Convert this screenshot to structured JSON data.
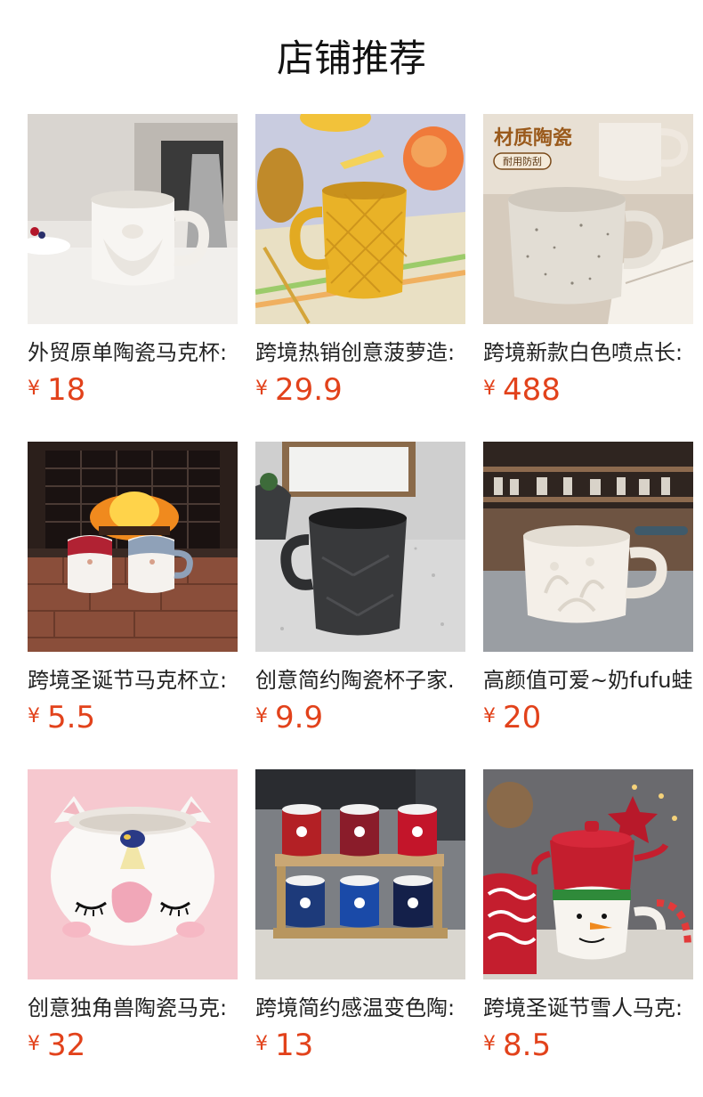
{
  "section": {
    "title": "店铺推荐"
  },
  "currency_symbol": "¥",
  "colors": {
    "price": "#e2421b",
    "title": "#111111",
    "text": "#222222"
  },
  "products": [
    {
      "name": "外贸原单陶瓷马克杯:",
      "price": "18",
      "image": "white-santa-mug"
    },
    {
      "name": "跨境热销创意菠萝造:",
      "price": "29.9",
      "image": "yellow-pineapple-mug"
    },
    {
      "name": "跨境新款白色喷点长:",
      "price": "488",
      "image": "speckled-white-mug",
      "image_badge": {
        "title": "材质陶瓷",
        "subtitle": "耐用防刮"
      }
    },
    {
      "name": "跨境圣诞节马克杯立:",
      "price": "5.5",
      "image": "santa-mugs-fireplace"
    },
    {
      "name": "创意简约陶瓷杯子家.",
      "price": "9.9",
      "image": "black-faceted-mug"
    },
    {
      "name": "高颜值可爱~奶fufu蛙",
      "price": "20",
      "image": "embossed-white-mug"
    },
    {
      "name": "创意独角兽陶瓷马克:",
      "price": "32",
      "image": "unicorn-mug"
    },
    {
      "name": "跨境简约感温变色陶:",
      "price": "13",
      "image": "football-club-mugs"
    },
    {
      "name": "跨境圣诞节雪人马克:",
      "price": "8.5",
      "image": "snowman-teapot-mug"
    }
  ]
}
